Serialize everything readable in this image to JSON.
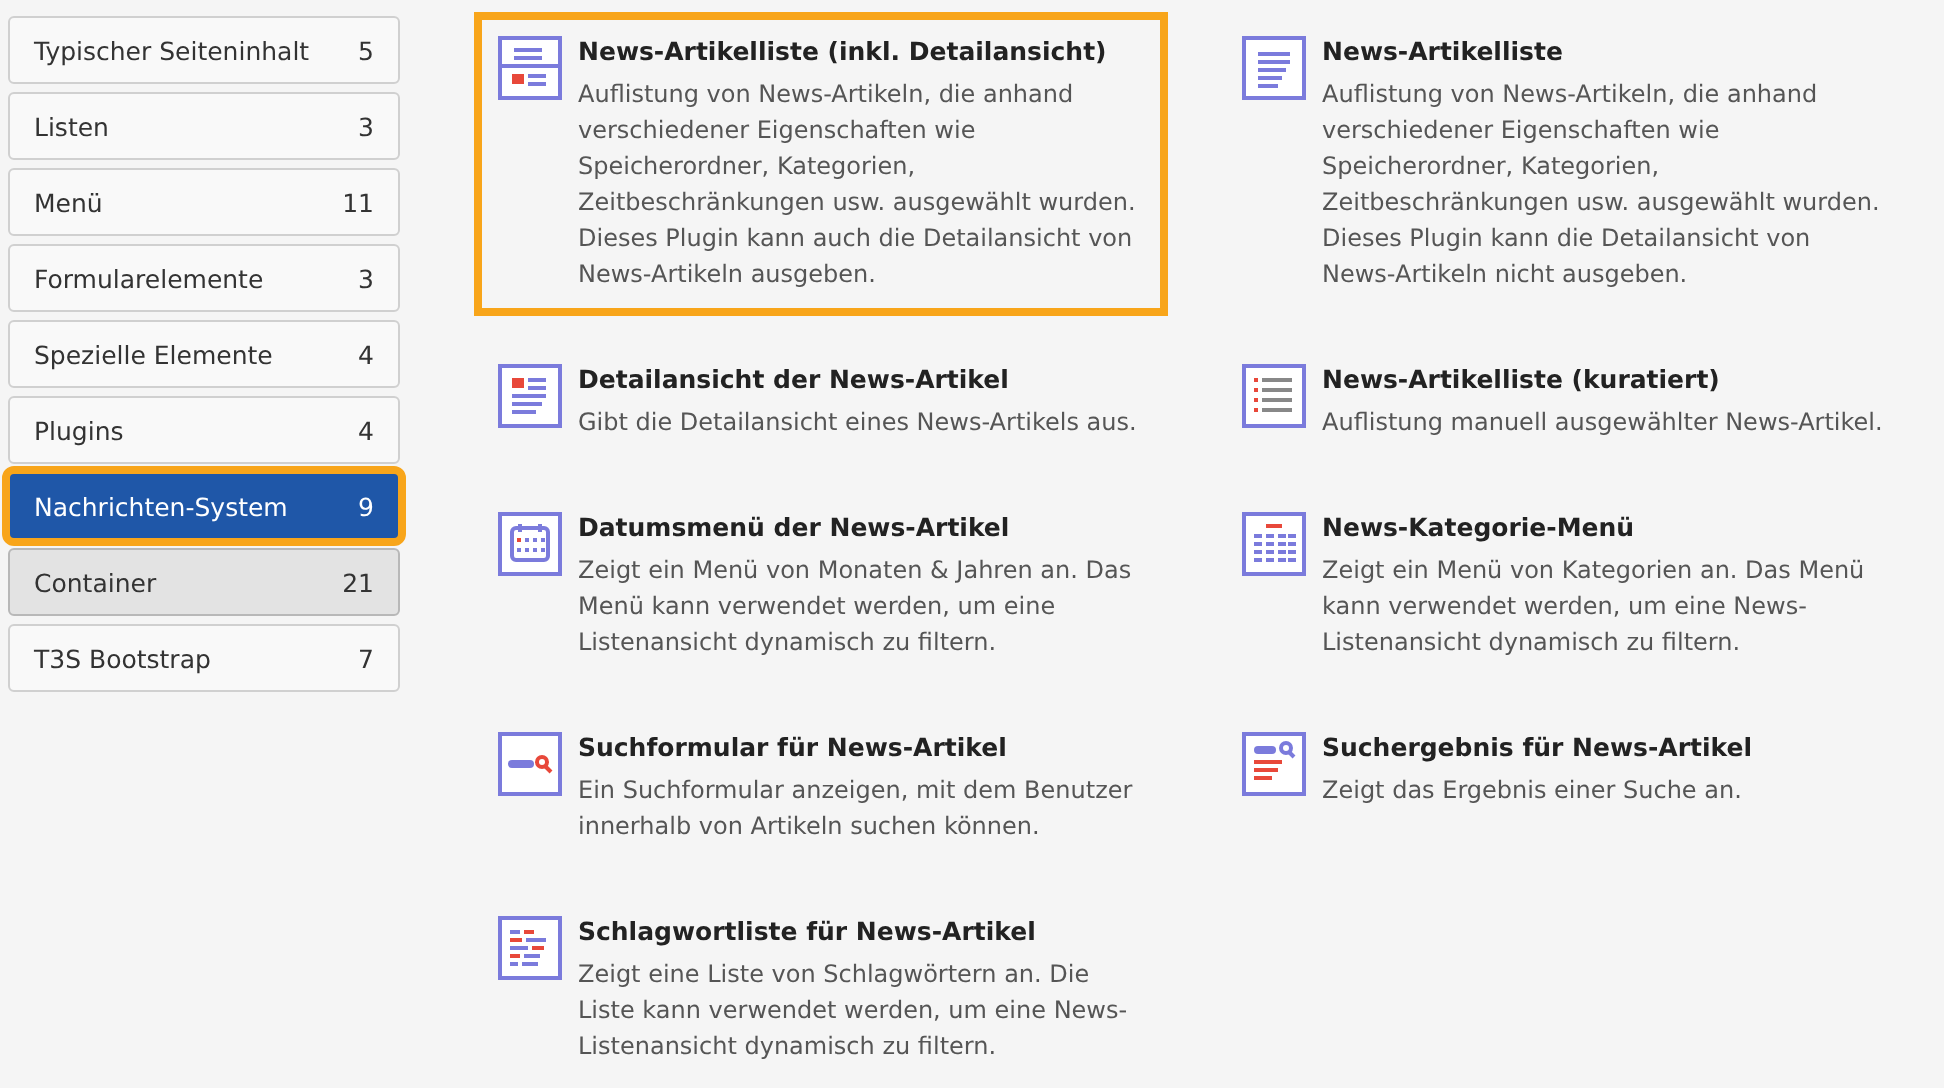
{
  "categories": [
    {
      "label": "Typischer Seiteninhalt",
      "count": "5",
      "selected": false,
      "hovered": false
    },
    {
      "label": "Listen",
      "count": "3",
      "selected": false,
      "hovered": false
    },
    {
      "label": "Menü",
      "count": "11",
      "selected": false,
      "hovered": false
    },
    {
      "label": "Formularelemente",
      "count": "3",
      "selected": false,
      "hovered": false
    },
    {
      "label": "Spezielle Elemente",
      "count": "4",
      "selected": false,
      "hovered": false
    },
    {
      "label": "Plugins",
      "count": "4",
      "selected": false,
      "hovered": false
    },
    {
      "label": "Nachrichten-System",
      "count": "9",
      "selected": true,
      "hovered": false
    },
    {
      "label": "Container",
      "count": "21",
      "selected": false,
      "hovered": true
    },
    {
      "label": "T3S Bootstrap",
      "count": "7",
      "selected": false,
      "hovered": false
    }
  ],
  "elements": [
    {
      "title": "News-Artikelliste (inkl. Detailansicht)",
      "description": "Auflistung von News-Artikeln, die anhand verschiedener Eigenschaften wie Speicherordner, Kategorien, Zeitbeschränkungen usw. ausgewählt wurden. Dieses Plugin kann auch die Detailansicht von News-Artikeln ausgeben.",
      "selected": true
    },
    {
      "title": "News-Artikelliste",
      "description": "Auflistung von News-Artikeln, die anhand verschiedener Eigenschaften wie Speicherordner, Kategorien, Zeitbeschränkungen usw. ausgewählt wurden. Dieses Plugin kann die Detailansicht von News-Artikeln nicht ausgeben.",
      "selected": false
    },
    {
      "title": "Detailansicht der News-Artikel",
      "description": "Gibt die Detailansicht eines News-Artikels aus.",
      "selected": false
    },
    {
      "title": "News-Artikelliste (kuratiert)",
      "description": "Auflistung manuell ausgewählter News-Artikel.",
      "selected": false
    },
    {
      "title": "Datumsmenü der News-Artikel",
      "description": "Zeigt ein Menü von Monaten & Jahren an. Das Menü kann verwendet werden, um eine Listenansicht dynamisch zu filtern.",
      "selected": false
    },
    {
      "title": "News-Kategorie-Menü",
      "description": "Zeigt ein Menü von Kategorien an. Das Menü kann verwendet werden, um eine News-Listenansicht dynamisch zu filtern.",
      "selected": false
    },
    {
      "title": "Suchformular für News-Artikel",
      "description": "Ein Suchformular anzeigen, mit dem Benutzer innerhalb von Artikeln suchen können.",
      "selected": false
    },
    {
      "title": "Suchergebnis für News-Artikel",
      "description": "Zeigt das Ergebnis einer Suche an.",
      "selected": false
    },
    {
      "title": "Schlagwortliste für News-Artikel",
      "description": "Zeigt eine Liste von Schlagwörtern an. Die Liste kann verwendet werden, um eine News-Listenansicht dynamisch zu filtern.",
      "selected": false
    }
  ]
}
